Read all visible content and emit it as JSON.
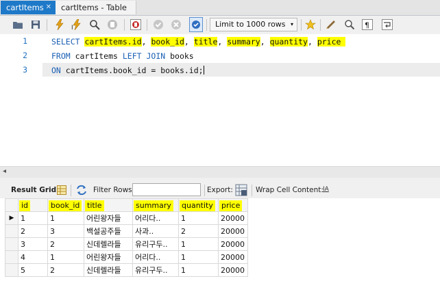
{
  "tabs": [
    {
      "label": "cartItems",
      "close": "✕"
    },
    {
      "label": "cartItems - Table"
    }
  ],
  "toolbar": {
    "limit_label": "Limit to 1000 rows",
    "limit_arrow": "▾"
  },
  "editor": {
    "line_numbers": [
      "1",
      "2",
      "3"
    ]
  },
  "result_toolbar": {
    "result_grid_label": "Result Grid",
    "filter_label": "Filter Rows:",
    "filter_value": "",
    "export_label": "Export:",
    "wrap_label": "Wrap Cell Content:",
    "wrap_icon": "IA"
  },
  "grid": {
    "columns": [
      "id",
      "book_id",
      "title",
      "summary",
      "quantity",
      "price"
    ],
    "rows": [
      [
        "1",
        "1",
        "어린왕자들",
        "어리다..",
        "1",
        "20000"
      ],
      [
        "2",
        "3",
        "백설공주들",
        "사과..",
        "2",
        "20000"
      ],
      [
        "3",
        "2",
        "신데렐라들",
        "유리구두..",
        "1",
        "20000"
      ],
      [
        "4",
        "1",
        "어린왕자들",
        "어리다..",
        "1",
        "20000"
      ],
      [
        "5",
        "2",
        "신데렐라들",
        "유리구두..",
        "1",
        "20000"
      ]
    ],
    "current_row_marker": "▶"
  },
  "colors": {
    "tab_active": "#1e79c8",
    "keyword": "#1a5fb4",
    "highlight": "#ffff00"
  }
}
